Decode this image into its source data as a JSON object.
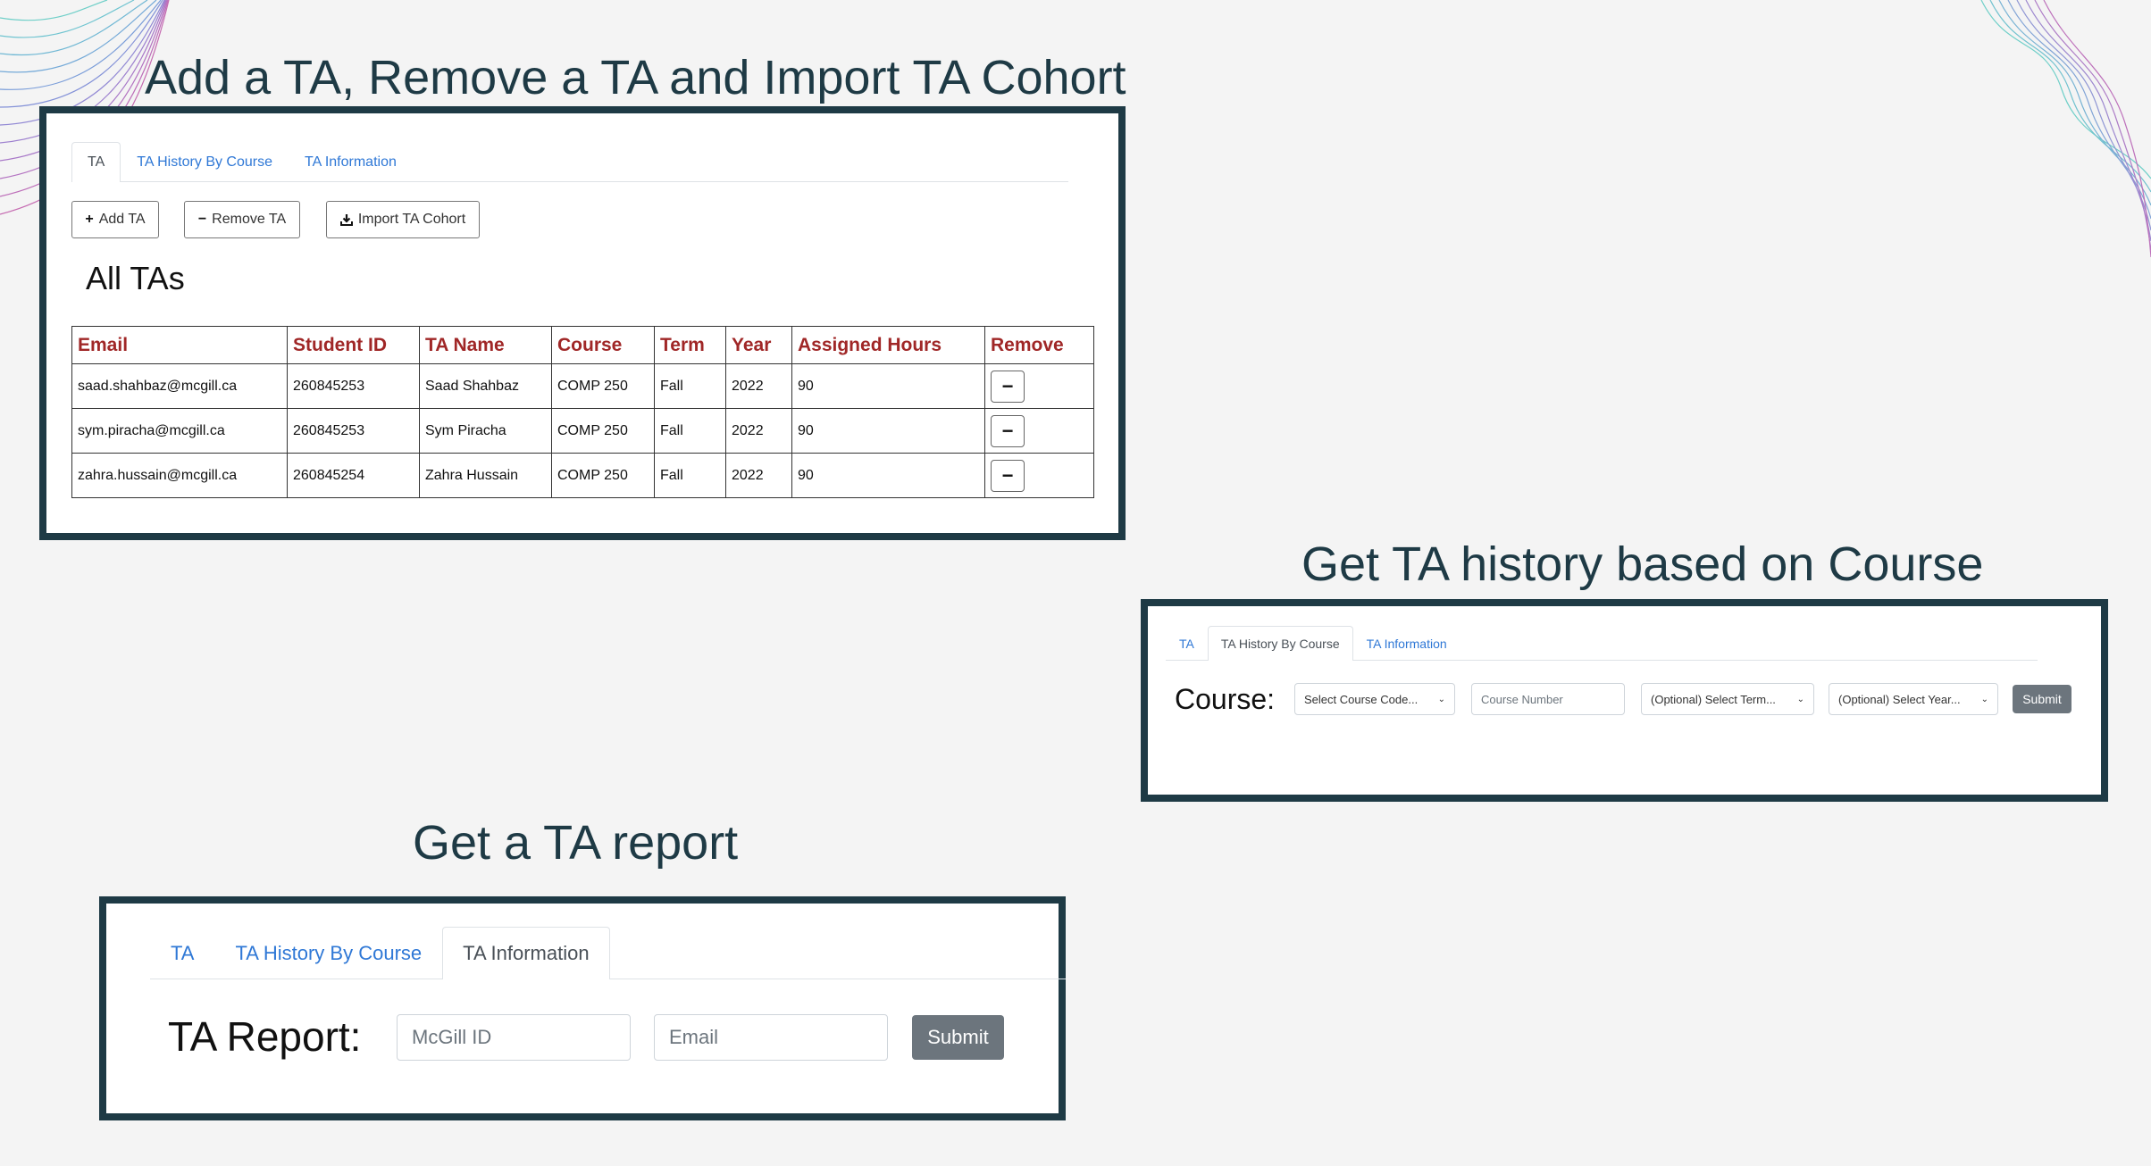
{
  "sections": {
    "add_remove": {
      "title": "Add a TA, Remove a TA and Import TA Cohort",
      "tabs": [
        "TA",
        "TA History By Course",
        "TA Information"
      ],
      "buttons": {
        "add": "Add TA",
        "remove": "Remove TA",
        "import": "Import TA Cohort"
      },
      "heading": "All TAs",
      "table": {
        "columns": [
          "Email",
          "Student ID",
          "TA Name",
          "Course",
          "Term",
          "Year",
          "Assigned Hours",
          "Remove"
        ],
        "rows": [
          [
            "saad.shahbaz@mcgill.ca",
            "260845253",
            "Saad Shahbaz",
            "COMP 250",
            "Fall",
            "2022",
            "90"
          ],
          [
            "sym.piracha@mcgill.ca",
            "260845253",
            "Sym Piracha",
            "COMP 250",
            "Fall",
            "2022",
            "90"
          ],
          [
            "zahra.hussain@mcgill.ca",
            "260845254",
            "Zahra Hussain",
            "COMP 250",
            "Fall",
            "2022",
            "90"
          ]
        ]
      }
    },
    "history": {
      "title": "Get TA history based on Course",
      "tabs": [
        "TA",
        "TA History By Course",
        "TA Information"
      ],
      "label": "Course:",
      "course_code_select": "Select Course Code...",
      "course_number_placeholder": "Course Number",
      "term_select": "(Optional) Select Term...",
      "year_select": "(Optional) Select Year...",
      "submit": "Submit"
    },
    "report": {
      "title": "Get a TA report",
      "tabs": [
        "TA",
        "TA History By Course",
        "TA Information"
      ],
      "label": "TA Report:",
      "mcgill_id_placeholder": "McGill ID",
      "email_placeholder": "Email",
      "submit": "Submit"
    }
  },
  "colors": {
    "frame_border": "#1e3a45",
    "link_blue": "#2f78d6",
    "table_header_red": "#a02727",
    "submit_gray": "#6c757d"
  },
  "icons": {
    "add": "plus-icon",
    "remove": "minus-icon",
    "import": "download-icon",
    "select": "chevron-down-icon"
  }
}
